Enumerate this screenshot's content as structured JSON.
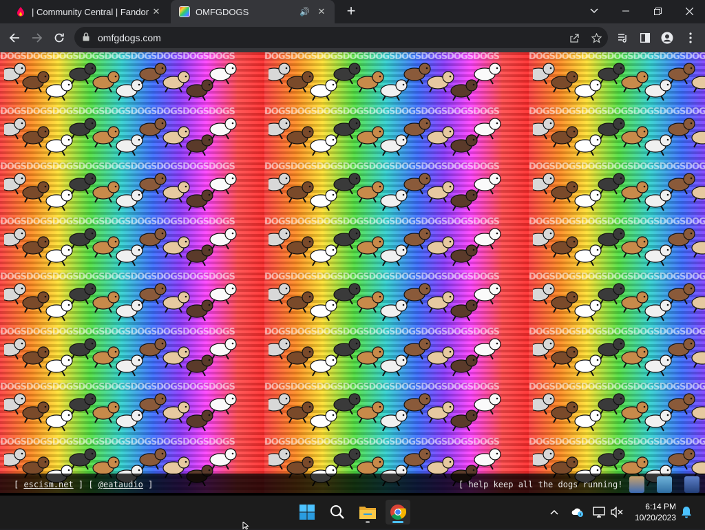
{
  "browser": {
    "tabs": [
      {
        "title": "| Community Central | Fandom",
        "close": "✕"
      },
      {
        "title": "OMFGDOGS",
        "close": "✕",
        "audio": "🔊"
      }
    ],
    "new_tab": "+",
    "window": {
      "chevron": "⌄",
      "minimize": "—",
      "restore": "❐",
      "close": "✕"
    },
    "url": "omfgdogs.com"
  },
  "page": {
    "wordmark": "DOGSDOGSDOGSDOGSDOGSDOGSDOGSDOGSDOGS",
    "footer": {
      "left_open": "[ ",
      "link1": "escism.net",
      "mid": " ] [ ",
      "link2": "@eataudio",
      "left_close": " ]",
      "right": "[ help keep all the dogs running! ]"
    }
  },
  "taskbar": {
    "apps": [
      "start",
      "search",
      "file-explorer",
      "chrome"
    ],
    "time": "6:14 PM",
    "date": "10/20/2023"
  },
  "colors": {
    "tab_bg": "#202124",
    "toolbar_bg": "#35363a",
    "taskbar_bg": "#1c1c1c",
    "accent_blue": "#4cc2ff"
  }
}
